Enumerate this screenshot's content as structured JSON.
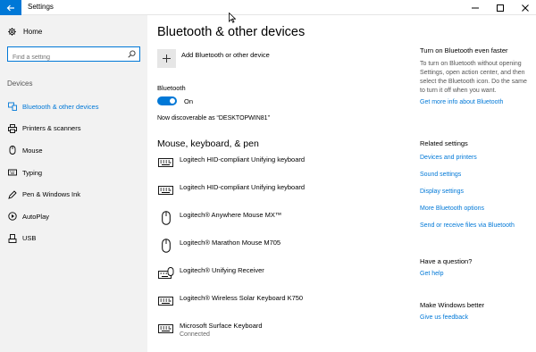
{
  "window": {
    "title": "Settings"
  },
  "sidebar": {
    "home_label": "Home",
    "search_placeholder": "Find a setting",
    "section_label": "Devices",
    "items": [
      {
        "label": "Bluetooth & other devices",
        "icon": "bluetooth-devices-icon",
        "active": true
      },
      {
        "label": "Printers & scanners",
        "icon": "printer-icon",
        "active": false
      },
      {
        "label": "Mouse",
        "icon": "mouse-icon",
        "active": false
      },
      {
        "label": "Typing",
        "icon": "keyboard-icon",
        "active": false
      },
      {
        "label": "Pen & Windows Ink",
        "icon": "pen-icon",
        "active": false
      },
      {
        "label": "AutoPlay",
        "icon": "autoplay-icon",
        "active": false
      },
      {
        "label": "USB",
        "icon": "usb-icon",
        "active": false
      }
    ]
  },
  "main": {
    "title": "Bluetooth & other devices",
    "add_device_label": "Add Bluetooth or other device",
    "bluetooth_label": "Bluetooth",
    "bluetooth_state": "On",
    "bluetooth_on": true,
    "discoverable_text": "Now discoverable as “DESKTOPWIN81”",
    "section_title": "Mouse, keyboard, & pen",
    "devices": [
      {
        "name": "Logitech HID-compliant Unifying keyboard",
        "icon": "keyboard-icon",
        "status": ""
      },
      {
        "name": "Logitech HID-compliant Unifying keyboard",
        "icon": "keyboard-icon",
        "status": ""
      },
      {
        "name": "Logitech® Anywhere Mouse MX™",
        "icon": "mouse-icon",
        "status": ""
      },
      {
        "name": "Logitech® Marathon Mouse M705",
        "icon": "mouse-icon",
        "status": ""
      },
      {
        "name": "Logitech® Unifying Receiver",
        "icon": "receiver-keyboard-icon",
        "status": ""
      },
      {
        "name": "Logitech® Wireless Solar Keyboard K750",
        "icon": "keyboard-icon",
        "status": ""
      },
      {
        "name": "Microsoft Surface Keyboard",
        "icon": "keyboard-icon",
        "status": "Connected"
      }
    ]
  },
  "right_panel": {
    "turn_on_heading": "Turn on Bluetooth even faster",
    "turn_on_text": "To turn on Bluetooth without opening Settings, open action center, and then select the Bluetooth icon. Do the same to turn it off when you want.",
    "more_info_link": "Get more info about Bluetooth",
    "related_heading": "Related settings",
    "related_links": [
      "Devices and printers",
      "Sound settings",
      "Display settings",
      "More Bluetooth options",
      "Send or receive files via Bluetooth"
    ],
    "question_heading": "Have a question?",
    "help_link": "Get help",
    "better_heading": "Make Windows better",
    "feedback_link": "Give us feedback"
  },
  "colors": {
    "accent": "#0078d7",
    "sidebar_bg": "#f2f2f2"
  }
}
